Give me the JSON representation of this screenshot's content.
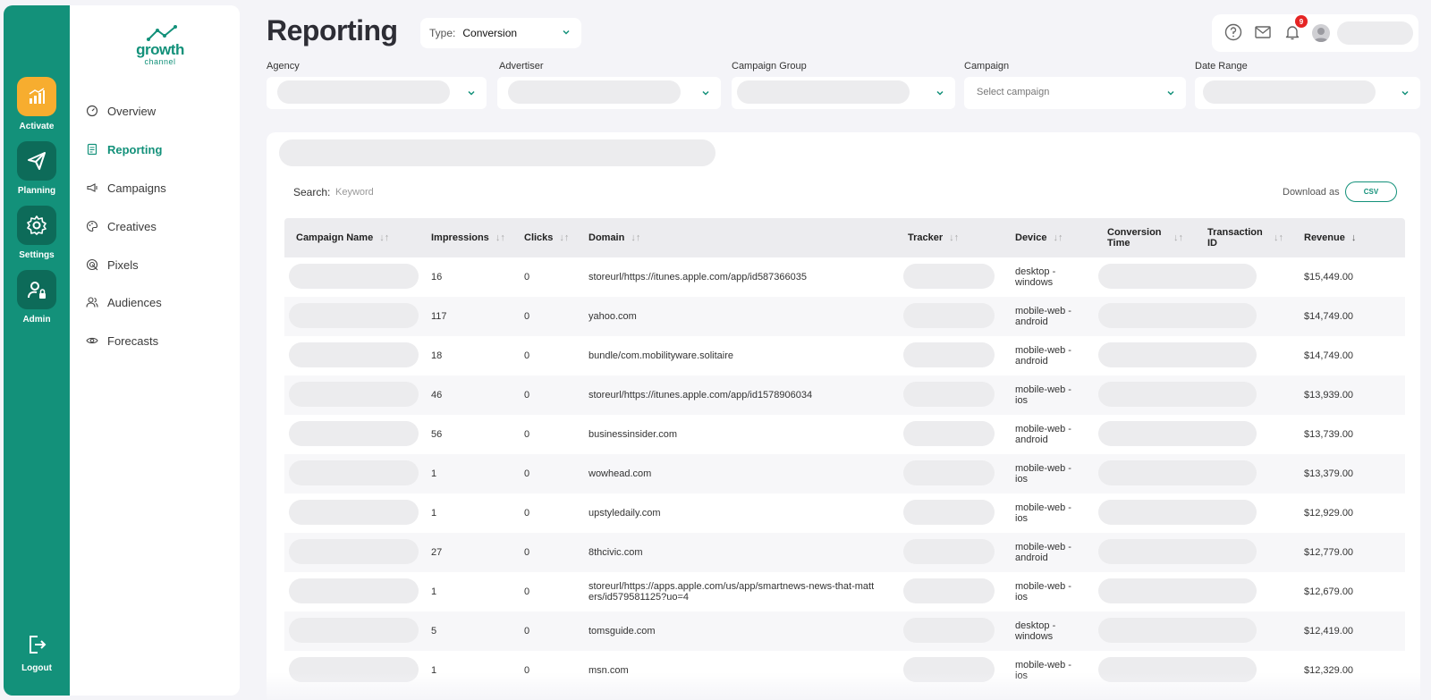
{
  "app": {
    "logo_text": "growth",
    "logo_sub": "channel"
  },
  "rail": {
    "items": [
      {
        "label": "Activate",
        "icon": "bar-chart-icon"
      },
      {
        "label": "Planning",
        "icon": "paper-plane-icon"
      },
      {
        "label": "Settings",
        "icon": "gear-icon"
      },
      {
        "label": "Admin",
        "icon": "user-lock-icon"
      }
    ],
    "logout_label": "Logout"
  },
  "sidebar": {
    "items": [
      {
        "label": "Overview",
        "icon": "gauge-icon"
      },
      {
        "label": "Reporting",
        "icon": "report-icon",
        "active": true
      },
      {
        "label": "Campaigns",
        "icon": "megaphone-icon"
      },
      {
        "label": "Creatives",
        "icon": "palette-icon"
      },
      {
        "label": "Pixels",
        "icon": "target-icon"
      },
      {
        "label": "Audiences",
        "icon": "people-icon"
      },
      {
        "label": "Forecasts",
        "icon": "eye-icon"
      }
    ]
  },
  "header": {
    "title": "Reporting",
    "type_label": "Type:",
    "type_value": "Conversion",
    "notification_count": "9"
  },
  "filters": {
    "agency_label": "Agency",
    "advertiser_label": "Advertiser",
    "campaign_group_label": "Campaign Group",
    "campaign_label": "Campaign",
    "campaign_placeholder": "Select campaign",
    "date_range_label": "Date Range"
  },
  "table": {
    "search_label": "Search:",
    "search_placeholder": "Keyword",
    "download_label": "Download as",
    "csv_label": "CSV",
    "columns": [
      {
        "label": "Campaign Name"
      },
      {
        "label": "Impressions"
      },
      {
        "label": "Clicks"
      },
      {
        "label": "Domain"
      },
      {
        "label": "Tracker"
      },
      {
        "label": "Device"
      },
      {
        "label": "Conversion Time"
      },
      {
        "label": "Transaction ID"
      },
      {
        "label": "Revenue"
      }
    ],
    "rows": [
      {
        "impressions": "16",
        "clicks": "0",
        "domain": "storeurl/https://itunes.apple.com/app/id587366035",
        "device": "desktop - windows",
        "revenue": "$15,449.00"
      },
      {
        "impressions": "117",
        "clicks": "0",
        "domain": "yahoo.com",
        "device": "mobile-web - android",
        "revenue": "$14,749.00"
      },
      {
        "impressions": "18",
        "clicks": "0",
        "domain": "bundle/com.mobilityware.solitaire",
        "device": "mobile-web - android",
        "revenue": "$14,749.00"
      },
      {
        "impressions": "46",
        "clicks": "0",
        "domain": "storeurl/https://itunes.apple.com/app/id1578906034",
        "device": "mobile-web - ios",
        "revenue": "$13,939.00"
      },
      {
        "impressions": "56",
        "clicks": "0",
        "domain": "businessinsider.com",
        "device": "mobile-web - android",
        "revenue": "$13,739.00"
      },
      {
        "impressions": "1",
        "clicks": "0",
        "domain": "wowhead.com",
        "device": "mobile-web - ios",
        "revenue": "$13,379.00"
      },
      {
        "impressions": "1",
        "clicks": "0",
        "domain": "upstyledaily.com",
        "device": "mobile-web - ios",
        "revenue": "$12,929.00"
      },
      {
        "impressions": "27",
        "clicks": "0",
        "domain": "8thcivic.com",
        "device": "mobile-web - android",
        "revenue": "$12,779.00"
      },
      {
        "impressions": "1",
        "clicks": "0",
        "domain": "storeurl/https://apps.apple.com/us/app/smartnews-news-that-matters/id579581125?uo=4",
        "device": "mobile-web - ios",
        "revenue": "$12,679.00"
      },
      {
        "impressions": "5",
        "clicks": "0",
        "domain": "tomsguide.com",
        "device": "desktop - windows",
        "revenue": "$12,419.00"
      },
      {
        "impressions": "1",
        "clicks": "0",
        "domain": "msn.com",
        "device": "mobile-web - ios",
        "revenue": "$12,329.00"
      }
    ]
  },
  "colors": {
    "brand": "#13917a",
    "accent": "#f7ad2f",
    "badge": "#e52424"
  }
}
